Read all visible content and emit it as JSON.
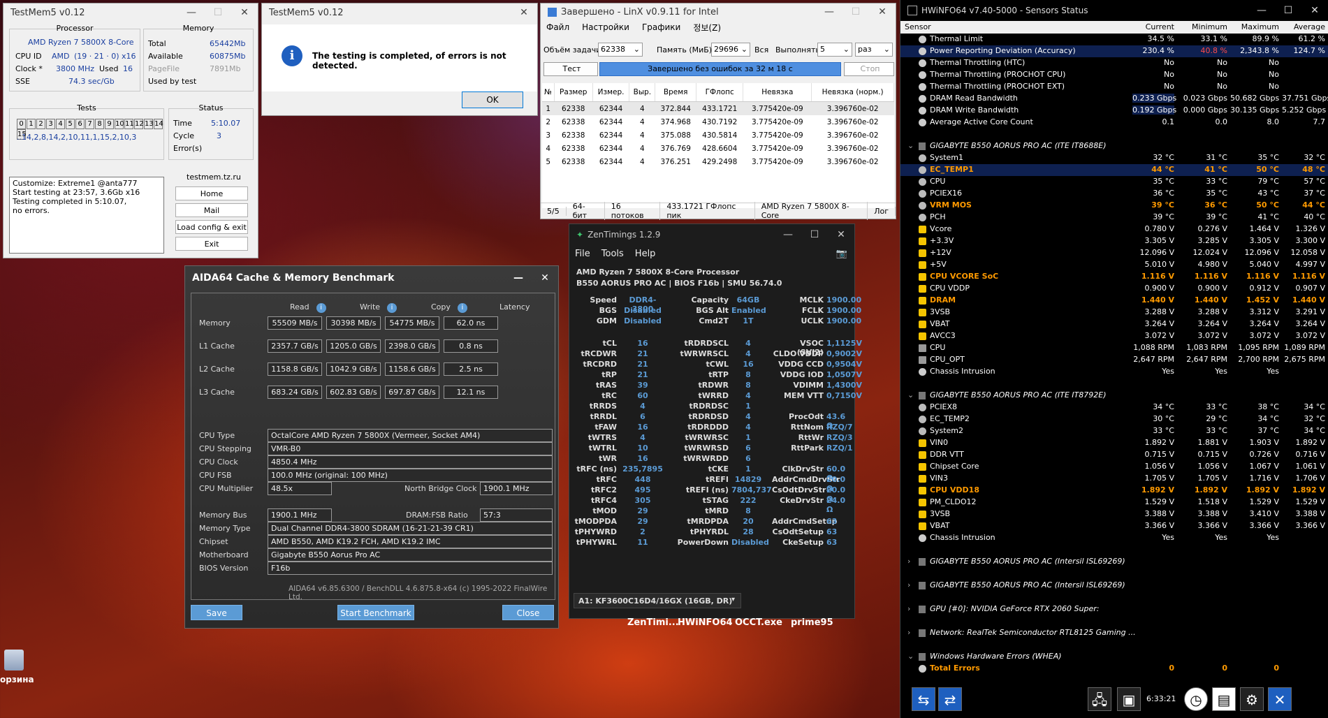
{
  "testmem": {
    "title": "TestMem5 v0.12",
    "processor_label": "Processor",
    "memory_label": "Memory",
    "cpu_name": "AMD Ryzen 7 5800X 8-Core",
    "cpu_id_label": "CPU ID",
    "cpu_id_vendor": "AMD",
    "cpu_id_val": "(19 · 21 · 0)",
    "cpu_id_threads": "x16",
    "clock_label": "Clock *",
    "clock_val": "3800 MHz",
    "used_label": "Used",
    "used_val": "16",
    "sse_label": "SSE",
    "sse_val": "74.3 sec/Gb",
    "total_label": "Total",
    "total_val": "65442Mb",
    "available_label": "Available",
    "available_val": "60875Mb",
    "pagefile_label": "PageFile",
    "pagefile_val": "7891Mb",
    "used_by_test_label": "Used by test",
    "tests_label": "Tests",
    "test_numbers": [
      "0",
      "1",
      "2",
      "3",
      "4",
      "5",
      "6",
      "7",
      "8",
      "9",
      "10",
      "11",
      "12",
      "13",
      "14",
      "15"
    ],
    "test_sequence": "..14,2,8,14,2,10,11,1,15,2,10,3",
    "status_label": "Status",
    "time_label": "Time",
    "time_val": "5:10.07",
    "cycle_label": "Cycle",
    "cycle_val": "3",
    "errors_label": "Error(s)",
    "log": [
      "Customize: Extreme1 @anta777",
      "Start testing at 23:57, 3.6Gb x16",
      "Testing completed in 5:10.07,",
      "no errors."
    ],
    "site": "testmem.tz.ru",
    "btn_home": "Home",
    "btn_mail": "Mail",
    "btn_load": "Load config & exit",
    "btn_exit": "Exit"
  },
  "msgbox": {
    "title": "TestMem5 v0.12",
    "text": "The testing is completed, of errors is not detected.",
    "ok": "OK",
    "info_icon": "i"
  },
  "linx": {
    "title": "Завершено - LinX v0.9.11 for Intel",
    "menu": [
      "Файл",
      "Настройки",
      "Графики",
      "정보(Z)"
    ],
    "task_label": "Объём задачи:",
    "task_val": "62338",
    "mem_label": "Память (МиБ):",
    "mem_val": "29696",
    "all_label": "Вся",
    "run_label": "Выполнять:",
    "run_val": "5",
    "run_unit": "раз",
    "test_btn": "Тест",
    "progress_text": "Завершено без ошибок за 32 м 18 с",
    "progress_fraction": 1.0,
    "stop_btn": "Стоп",
    "columns": [
      "№",
      "Размер",
      "Измер.",
      "Выр.",
      "Время",
      "ГФлопс",
      "Невязка",
      "Невязка (норм.)"
    ],
    "rows": [
      [
        "1",
        "62338",
        "62344",
        "4",
        "372.844",
        "433.1721",
        "3.775420e-09",
        "3.396760e-02"
      ],
      [
        "2",
        "62338",
        "62344",
        "4",
        "374.968",
        "430.7192",
        "3.775420e-09",
        "3.396760e-02"
      ],
      [
        "3",
        "62338",
        "62344",
        "4",
        "375.088",
        "430.5814",
        "3.775420e-09",
        "3.396760e-02"
      ],
      [
        "4",
        "62338",
        "62344",
        "4",
        "376.769",
        "428.6604",
        "3.775420e-09",
        "3.396760e-02"
      ],
      [
        "5",
        "62338",
        "62344",
        "4",
        "376.251",
        "429.2498",
        "3.775420e-09",
        "3.396760e-02"
      ]
    ],
    "status": [
      "5/5",
      "64-бит",
      "16 потоков",
      "433.1721 ГФлопс пик",
      "AMD Ryzen 7 5800X 8-Core",
      "Лог"
    ]
  },
  "aida": {
    "title": "AIDA64 Cache & Memory Benchmark",
    "col_read": "Read",
    "col_write": "Write",
    "col_copy": "Copy",
    "col_latency": "Latency",
    "rows": [
      {
        "label": "Memory",
        "read": "55509 MB/s",
        "write": "30398 MB/s",
        "copy": "54775 MB/s",
        "latency": "62.0 ns"
      },
      {
        "label": "L1 Cache",
        "read": "2357.7 GB/s",
        "write": "1205.0 GB/s",
        "copy": "2398.0 GB/s",
        "latency": "0.8 ns"
      },
      {
        "label": "L2 Cache",
        "read": "1158.8 GB/s",
        "write": "1042.9 GB/s",
        "copy": "1158.6 GB/s",
        "latency": "2.5 ns"
      },
      {
        "label": "L3 Cache",
        "read": "683.24 GB/s",
        "write": "602.83 GB/s",
        "copy": "697.87 GB/s",
        "latency": "12.1 ns"
      }
    ],
    "cpu_type_label": "CPU Type",
    "cpu_type": "OctalCore AMD Ryzen 7 5800X  (Vermeer, Socket AM4)",
    "cpu_stepping_label": "CPU Stepping",
    "cpu_stepping": "VMR-B0",
    "cpu_clock_label": "CPU Clock",
    "cpu_clock": "4850.4 MHz",
    "cpu_fsb_label": "CPU FSB",
    "cpu_fsb": "100.0 MHz  (original: 100 MHz)",
    "cpu_mult_label": "CPU Multiplier",
    "cpu_mult": "48.5x",
    "nb_clock_label": "North Bridge Clock",
    "nb_clock": "1900.1 MHz",
    "mem_bus_label": "Memory Bus",
    "mem_bus": "1900.1 MHz",
    "dram_fsb_label": "DRAM:FSB Ratio",
    "dram_fsb": "57:3",
    "mem_type_label": "Memory Type",
    "mem_type": "Dual Channel DDR4-3800 SDRAM  (16-21-21-39 CR1)",
    "chipset_label": "Chipset",
    "chipset": "AMD B550, AMD K19.2 FCH, AMD K19.2 IMC",
    "mobo_label": "Motherboard",
    "mobo": "Gigabyte B550 Aorus Pro AC",
    "bios_label": "BIOS Version",
    "bios": "F16b",
    "footer": "AIDA64 v6.85.6300 / BenchDLL 4.6.875.8-x64  (c) 1995-2022 FinalWire Ltd.",
    "btn_save": "Save",
    "btn_start": "Start Benchmark",
    "btn_close": "Close"
  },
  "zen": {
    "title": "ZenTimings 1.2.9",
    "menu": [
      "File",
      "Tools",
      "Help"
    ],
    "cpu": "AMD Ryzen 7 5800X 8-Core Processor",
    "board": "B550 AORUS PRO AC | BIOS F16b | SMU 56.74.0",
    "top": [
      [
        "Speed",
        "DDR4-3800",
        "Capacity",
        "64GB",
        "MCLK",
        "1900.00"
      ],
      [
        "BGS",
        "Disabled",
        "BGS Alt",
        "Enabled",
        "FCLK",
        "1900.00"
      ],
      [
        "GDM",
        "Disabled",
        "Cmd2T",
        "1T",
        "UCLK",
        "1900.00"
      ]
    ],
    "timings": [
      [
        "tCL",
        "16",
        "tRDRDSCL",
        "4",
        "VSOC (SVI2)",
        "1,1125V"
      ],
      [
        "tRCDWR",
        "21",
        "tWRWRSCL",
        "4",
        "CLDO VDDP",
        "0,9002V"
      ],
      [
        "tRCDRD",
        "21",
        "tCWL",
        "16",
        "VDDG CCD",
        "0,9504V"
      ],
      [
        "tRP",
        "21",
        "tRTP",
        "8",
        "VDDG IOD",
        "1,0507V"
      ],
      [
        "tRAS",
        "39",
        "tRDWR",
        "8",
        "VDIMM",
        "1,4300V"
      ],
      [
        "tRC",
        "60",
        "tWRRD",
        "4",
        "MEM VTT",
        "0,7150V"
      ],
      [
        "tRRDS",
        "4",
        "tRDRDSC",
        "1",
        "",
        ""
      ],
      [
        "tRRDL",
        "6",
        "tRDRDSD",
        "4",
        "ProcOdt",
        "43.6 Ω"
      ],
      [
        "tFAW",
        "16",
        "tRDRDDD",
        "4",
        "RttNom",
        "RZQ/7"
      ],
      [
        "tWTRS",
        "4",
        "tWRWRSC",
        "1",
        "RttWr",
        "RZQ/3"
      ],
      [
        "tWTRL",
        "10",
        "tWRWRSD",
        "6",
        "RttPark",
        "RZQ/1"
      ],
      [
        "tWR",
        "16",
        "tWRWRDD",
        "6",
        "",
        ""
      ],
      [
        "tRFC (ns)",
        "235,7895",
        "tCKE",
        "1",
        "ClkDrvStr",
        "60.0 Ω"
      ],
      [
        "tRFC",
        "448",
        "tREFI",
        "14829",
        "AddrCmdDrvStr",
        "20.0 Ω"
      ],
      [
        "tRFC2",
        "495",
        "tREFI (ns)",
        "7804,737",
        "CsOdtDrvStr",
        "20.0 Ω"
      ],
      [
        "tRFC4",
        "305",
        "tSTAG",
        "222",
        "CkeDrvStr",
        "24.0 Ω"
      ],
      [
        "tMOD",
        "29",
        "tMRD",
        "8",
        "",
        ""
      ],
      [
        "tMODPDA",
        "29",
        "tMRDPDA",
        "20",
        "AddrCmdSetup",
        "63"
      ],
      [
        "tPHYWRD",
        "2",
        "tPHYRDL",
        "28",
        "CsOdtSetup",
        "63"
      ],
      [
        "tPHYWRL",
        "11",
        "PowerDown",
        "Disabled",
        "CkeSetup",
        "63"
      ]
    ],
    "dimm": "A1: KF3600C16D4/16GX (16GB, DR)"
  },
  "taskbar": [
    "ZenTimi...",
    "HWiNFO64",
    "OCCT.exe",
    "prime95"
  ],
  "desktop_label": "орзина",
  "hwinfo": {
    "title": "HWiNFO64 v7.40-5000 - Sensors Status",
    "cols": [
      "Sensor",
      "Current",
      "Minimum",
      "Maximum",
      "Average"
    ],
    "rows": [
      {
        "t": "s",
        "i": "c",
        "n": "Thermal Limit",
        "v": [
          "34.5 %",
          "33.1 %",
          "89.9 %",
          "61.2 %"
        ]
      },
      {
        "t": "s",
        "i": "c",
        "n": "Power Reporting Deviation (Accuracy)",
        "v": [
          "230.4 %",
          "40.8 %",
          "2,343.8 %",
          "124.7 %"
        ],
        "sel": true,
        "red": true
      },
      {
        "t": "s",
        "i": "c",
        "n": "Thermal Throttling (HTC)",
        "v": [
          "No",
          "No",
          "No",
          ""
        ]
      },
      {
        "t": "s",
        "i": "c",
        "n": "Thermal Throttling (PROCHOT CPU)",
        "v": [
          "No",
          "No",
          "No",
          ""
        ]
      },
      {
        "t": "s",
        "i": "c",
        "n": "Thermal Throttling (PROCHOT EXT)",
        "v": [
          "No",
          "No",
          "No",
          ""
        ]
      },
      {
        "t": "s",
        "i": "c",
        "n": "DRAM Read Bandwidth",
        "v": [
          "0.233 Gbps",
          "0.023 Gbps",
          "50.682 Gbps",
          "37.751 Gbps"
        ]
      },
      {
        "t": "s",
        "i": "c",
        "n": "DRAM Write Bandwidth",
        "v": [
          "0.192 Gbps",
          "0.000 Gbps",
          "30.135 Gbps",
          "5.252 Gbps"
        ]
      },
      {
        "t": "s",
        "i": "c",
        "n": "Average Active Core Count",
        "v": [
          "0.1",
          "0.0",
          "8.0",
          "7.7"
        ]
      },
      {
        "t": "g",
        "n": "GIGABYTE B550 AORUS PRO AC (ITE IT8688E)"
      },
      {
        "t": "s",
        "i": "t",
        "n": "System1",
        "v": [
          "32 °C",
          "31 °C",
          "35 °C",
          "32 °C"
        ]
      },
      {
        "t": "s",
        "i": "t",
        "n": "EC_TEMP1",
        "v": [
          "44 °C",
          "41 °C",
          "50 °C",
          "48 °C"
        ],
        "o": true,
        "sel": true
      },
      {
        "t": "s",
        "i": "t",
        "n": "CPU",
        "v": [
          "35 °C",
          "33 °C",
          "79 °C",
          "57 °C"
        ]
      },
      {
        "t": "s",
        "i": "t",
        "n": "PCIEX16",
        "v": [
          "36 °C",
          "35 °C",
          "43 °C",
          "37 °C"
        ]
      },
      {
        "t": "s",
        "i": "t",
        "n": "VRM MOS",
        "v": [
          "39 °C",
          "36 °C",
          "50 °C",
          "44 °C"
        ],
        "o": true
      },
      {
        "t": "s",
        "i": "t",
        "n": "PCH",
        "v": [
          "39 °C",
          "39 °C",
          "41 °C",
          "40 °C"
        ]
      },
      {
        "t": "s",
        "i": "v",
        "n": "Vcore",
        "v": [
          "0.780 V",
          "0.276 V",
          "1.464 V",
          "1.326 V"
        ]
      },
      {
        "t": "s",
        "i": "v",
        "n": "+3.3V",
        "v": [
          "3.305 V",
          "3.285 V",
          "3.305 V",
          "3.300 V"
        ]
      },
      {
        "t": "s",
        "i": "v",
        "n": "+12V",
        "v": [
          "12.096 V",
          "12.024 V",
          "12.096 V",
          "12.058 V"
        ]
      },
      {
        "t": "s",
        "i": "v",
        "n": "+5V",
        "v": [
          "5.010 V",
          "4.980 V",
          "5.040 V",
          "4.997 V"
        ]
      },
      {
        "t": "s",
        "i": "v",
        "n": "CPU VCORE SoC",
        "v": [
          "1.116 V",
          "1.116 V",
          "1.116 V",
          "1.116 V"
        ],
        "o": true
      },
      {
        "t": "s",
        "i": "v",
        "n": "CPU VDDP",
        "v": [
          "0.900 V",
          "0.900 V",
          "0.912 V",
          "0.907 V"
        ]
      },
      {
        "t": "s",
        "i": "v",
        "n": "DRAM",
        "v": [
          "1.440 V",
          "1.440 V",
          "1.452 V",
          "1.440 V"
        ],
        "o": true
      },
      {
        "t": "s",
        "i": "v",
        "n": "3VSB",
        "v": [
          "3.288 V",
          "3.288 V",
          "3.312 V",
          "3.291 V"
        ]
      },
      {
        "t": "s",
        "i": "v",
        "n": "VBAT",
        "v": [
          "3.264 V",
          "3.264 V",
          "3.264 V",
          "3.264 V"
        ]
      },
      {
        "t": "s",
        "i": "v",
        "n": "AVCC3",
        "v": [
          "3.072 V",
          "3.072 V",
          "3.072 V",
          "3.072 V"
        ]
      },
      {
        "t": "s",
        "i": "f",
        "n": "CPU",
        "v": [
          "1,088 RPM",
          "1,083 RPM",
          "1,095 RPM",
          "1,089 RPM"
        ]
      },
      {
        "t": "s",
        "i": "f",
        "n": "CPU_OPT",
        "v": [
          "2,647 RPM",
          "2,647 RPM",
          "2,700 RPM",
          "2,675 RPM"
        ]
      },
      {
        "t": "s",
        "i": "c",
        "n": "Chassis Intrusion",
        "v": [
          "Yes",
          "Yes",
          "Yes",
          ""
        ]
      },
      {
        "t": "g",
        "n": "GIGABYTE B550 AORUS PRO AC (ITE IT8792E)"
      },
      {
        "t": "s",
        "i": "t",
        "n": "PCIEX8",
        "v": [
          "34 °C",
          "33 °C",
          "38 °C",
          "34 °C"
        ]
      },
      {
        "t": "s",
        "i": "t",
        "n": "EC_TEMP2",
        "v": [
          "30 °C",
          "29 °C",
          "34 °C",
          "32 °C"
        ]
      },
      {
        "t": "s",
        "i": "t",
        "n": "System2",
        "v": [
          "33 °C",
          "33 °C",
          "37 °C",
          "34 °C"
        ]
      },
      {
        "t": "s",
        "i": "v",
        "n": "VIN0",
        "v": [
          "1.892 V",
          "1.881 V",
          "1.903 V",
          "1.892 V"
        ]
      },
      {
        "t": "s",
        "i": "v",
        "n": "DDR VTT",
        "v": [
          "0.715 V",
          "0.715 V",
          "0.726 V",
          "0.716 V"
        ]
      },
      {
        "t": "s",
        "i": "v",
        "n": "Chipset Core",
        "v": [
          "1.056 V",
          "1.056 V",
          "1.067 V",
          "1.061 V"
        ]
      },
      {
        "t": "s",
        "i": "v",
        "n": "VIN3",
        "v": [
          "1.705 V",
          "1.705 V",
          "1.716 V",
          "1.706 V"
        ]
      },
      {
        "t": "s",
        "i": "v",
        "n": "CPU VDD18",
        "v": [
          "1.892 V",
          "1.892 V",
          "1.892 V",
          "1.892 V"
        ],
        "o": true
      },
      {
        "t": "s",
        "i": "v",
        "n": "PM_CLDO12",
        "v": [
          "1.529 V",
          "1.518 V",
          "1.529 V",
          "1.529 V"
        ]
      },
      {
        "t": "s",
        "i": "v",
        "n": "3VSB",
        "v": [
          "3.388 V",
          "3.388 V",
          "3.410 V",
          "3.388 V"
        ]
      },
      {
        "t": "s",
        "i": "v",
        "n": "VBAT",
        "v": [
          "3.366 V",
          "3.366 V",
          "3.366 V",
          "3.366 V"
        ]
      },
      {
        "t": "s",
        "i": "c",
        "n": "Chassis Intrusion",
        "v": [
          "Yes",
          "Yes",
          "Yes",
          ""
        ]
      },
      {
        "t": "g",
        "n": "GIGABYTE B550 AORUS PRO AC (Intersil ISL69269)",
        "c": true
      },
      {
        "t": "g",
        "n": "GIGABYTE B550 AORUS PRO AC (Intersil ISL69269)",
        "c": true
      },
      {
        "t": "g",
        "n": "GPU [#0]: NVIDIA GeForce RTX 2060 Super:",
        "c": true
      },
      {
        "t": "g",
        "n": "Network: RealTek Semiconductor RTL8125 Gaming ...",
        "c": true
      },
      {
        "t": "g",
        "n": "Windows Hardware Errors (WHEA)"
      },
      {
        "t": "s",
        "i": "c",
        "n": "Total Errors",
        "v": [
          "0",
          "0",
          "0",
          ""
        ],
        "o": true
      }
    ],
    "clock": "6:33:21"
  }
}
